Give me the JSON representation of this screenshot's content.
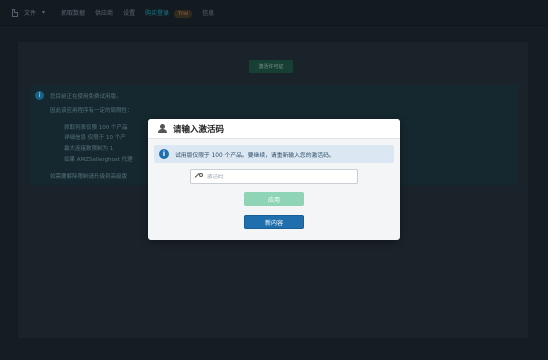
{
  "topbar": {
    "file_label": "文件",
    "menu": [
      {
        "label": "抓取数据"
      },
      {
        "label": "供应商"
      },
      {
        "label": "设置"
      },
      {
        "label": "购买登录"
      },
      {
        "label": "信息"
      }
    ],
    "trial_badge": "Trial",
    "accent_color": "#1fb0c8"
  },
  "background": {
    "activate_button": "激活许可证",
    "info_lines": [
      "您目前正在使用免费试用版。",
      "因此该应用程序有一定的局限性：",
      "抓取列表仅限 100 个产品",
      "详细信息 仅限于 10 个产",
      "最大连接数限制为 1",
      "如果 AMZSellerghost 代理",
      "如需要解除限制请升级到高级版"
    ]
  },
  "modal": {
    "title": "请输入激活码",
    "alert_text": "试用版仅限于 100 个产品。要继续，请重新输入您的激活码。",
    "code_placeholder": "激活码",
    "code_value": "",
    "apply_label": "应用",
    "buy_label": "新内容"
  }
}
